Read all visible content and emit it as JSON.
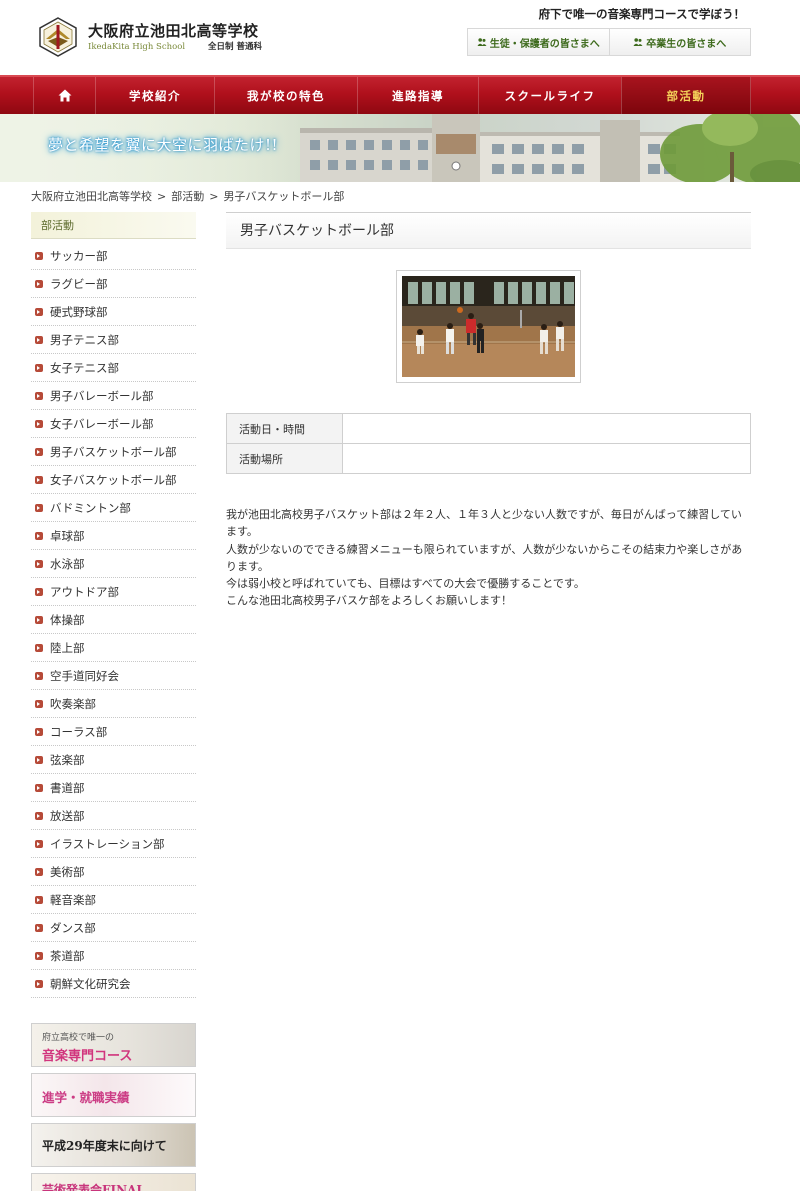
{
  "header": {
    "school_name": "大阪府立池田北高等学校",
    "school_name_en": "IkedaKita High School",
    "school_type": "全日制 普通科",
    "tagline": "府下で唯一の音楽専門コースで学ぼう！",
    "top_links": [
      {
        "label": "生徒・保護者の皆さまへ",
        "icon": "person-icon"
      },
      {
        "label": "卒業生の皆さまへ",
        "icon": "person-icon"
      }
    ]
  },
  "nav": {
    "items": [
      {
        "label": "",
        "icon": "home-icon"
      },
      {
        "label": "学校紹介"
      },
      {
        "label": "我が校の特色"
      },
      {
        "label": "進路指導"
      },
      {
        "label": "スクールライフ"
      },
      {
        "label": "部活動",
        "active": true
      }
    ]
  },
  "banner": {
    "catchphrase": "夢と希望を翼に大空に羽ばたけ!!"
  },
  "breadcrumb": [
    "大阪府立池田北高等学校",
    "部活動",
    "男子バスケットボール部"
  ],
  "sidebar": {
    "heading": "部活動",
    "items": [
      "サッカー部",
      "ラグビー部",
      "硬式野球部",
      "男子テニス部",
      "女子テニス部",
      "男子バレーボール部",
      "女子バレーボール部",
      "男子バスケットボール部",
      "女子バスケットボール部",
      "バドミントン部",
      "卓球部",
      "水泳部",
      "アウトドア部",
      "体操部",
      "陸上部",
      "空手道同好会",
      "吹奏楽部",
      "コーラス部",
      "弦楽部",
      "書道部",
      "放送部",
      "イラストレーション部",
      "美術部",
      "軽音楽部",
      "ダンス部",
      "茶道部",
      "朝鮮文化研究会"
    ],
    "banners": {
      "music_small": "府立高校で唯一の",
      "music_big": "音楽専門コース",
      "career": "進学・就職実績",
      "plan": "平成29年度末に向けて",
      "concert": "芸術発表会FINAL"
    }
  },
  "main": {
    "title": "男子バスケットボール部",
    "table": [
      {
        "label": "活動日・時間",
        "value": ""
      },
      {
        "label": "活動場所",
        "value": ""
      }
    ],
    "body": [
      "我が池田北高校男子バスケット部は２年２人、１年３人と少ない人数ですが、毎日がんばって練習しています。",
      "人数が少ないのでできる練習メニューも限られていますが、人数が少ないからこその結束力や楽しさがあります。",
      "今は弱小校と呼ばれていても、目標はすべての大会で優勝することです。",
      "こんな池田北高校男子バスケ部をよろしくお願いします！"
    ]
  },
  "colors": {
    "nav_red": "#b0101c",
    "nav_active_text": "#f5d25a",
    "link_green": "#3d6a1c",
    "bullet": "#b64a38"
  }
}
